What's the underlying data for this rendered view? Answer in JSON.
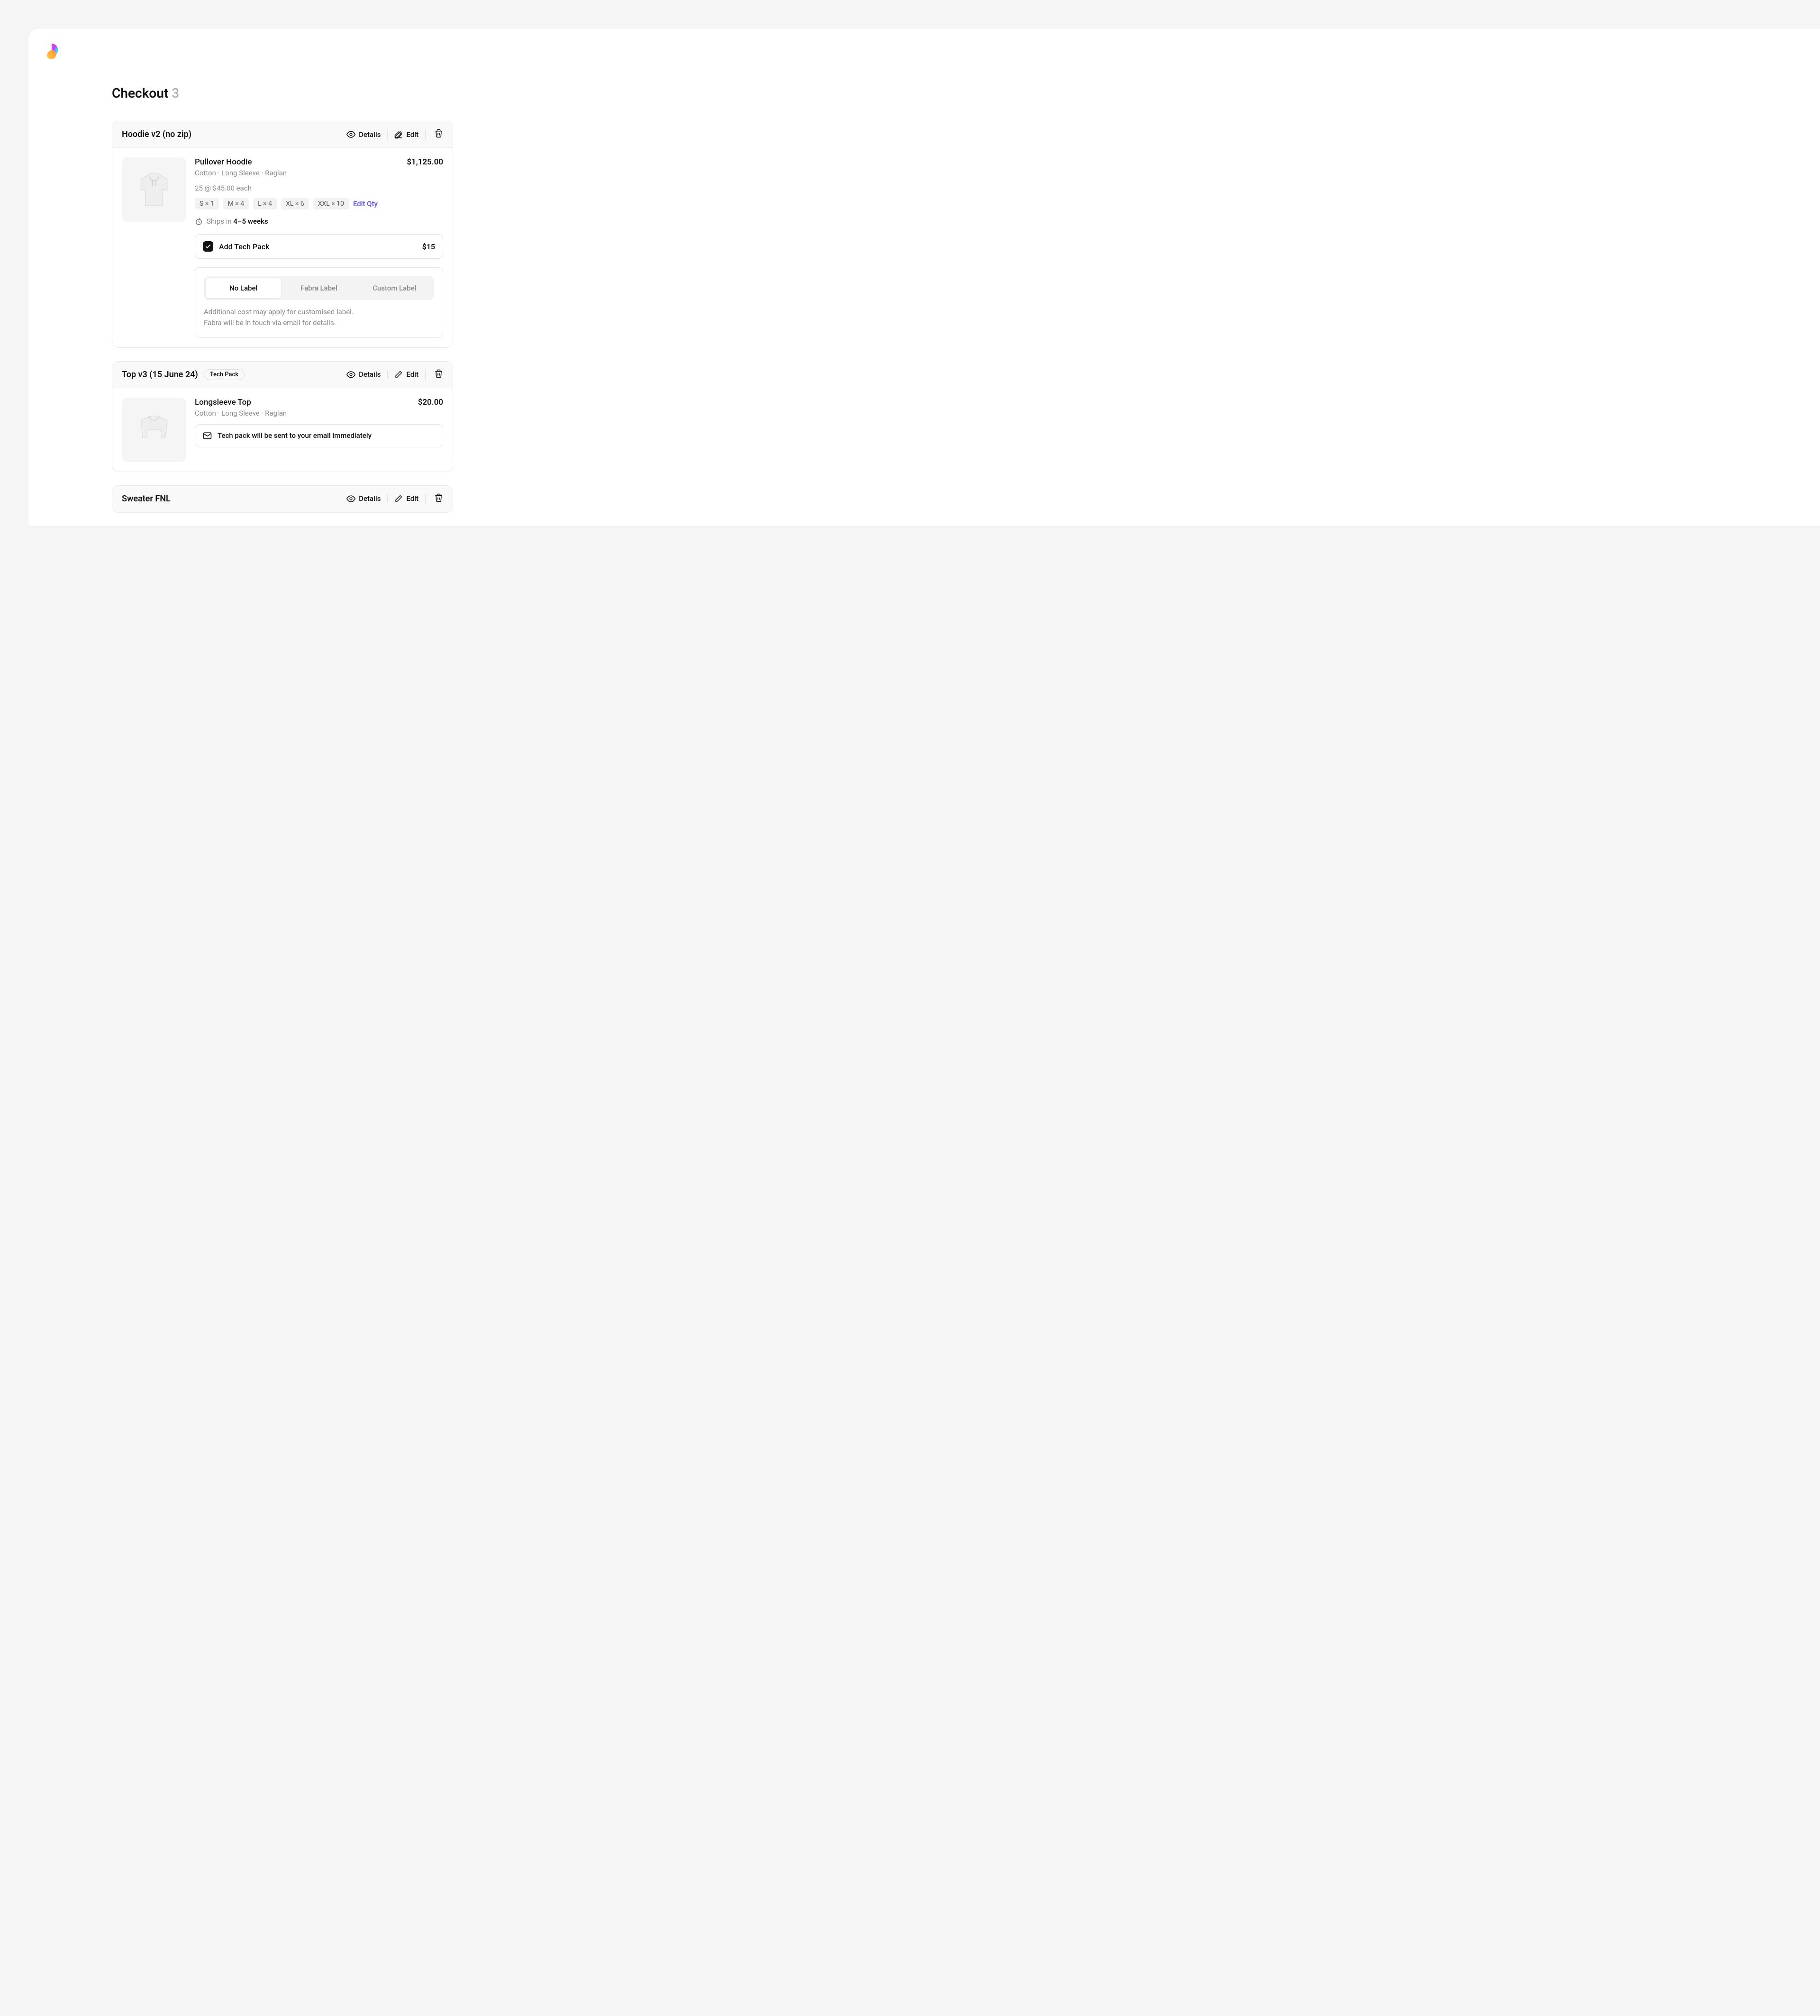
{
  "title": {
    "text": "Checkout",
    "count": "3"
  },
  "actions": {
    "details": "Details",
    "edit": "Edit"
  },
  "labelOptions": {
    "none": "No Label",
    "fabra": "Fabra Label",
    "custom": "Custom Label"
  },
  "labelNote": {
    "l1": "Additional cost may apply for customised label.",
    "l2": "Fabra will be in touch via email for details."
  },
  "editQty": "Edit Qty",
  "items": [
    {
      "title": "Hoodie v2 (no zip)",
      "name": "Pullover Hoodie",
      "price": "$1,125.00",
      "meta": "Cotton   ·   Long Sleeve   ·   Raglan",
      "qty": "25 @ $45.00 each",
      "sizes": [
        "S × 1",
        "M × 4",
        "L × 4",
        "XL × 6",
        "XXL × 10"
      ],
      "ships": {
        "pre": "Ships in ",
        "bold": "4–5 weeks"
      },
      "addon": {
        "label": "Add Tech Pack",
        "price": "$15",
        "checked": true
      },
      "hasLabel": true
    },
    {
      "title": "Top v3 (15 June 24)",
      "pill": "Tech Pack",
      "name": "Longsleeve Top",
      "price": "$20.00",
      "meta": "Cotton   ·   Long Sleeve   ·   Raglan",
      "info": "Tech pack will be sent to your email immediately"
    },
    {
      "title": "Sweater FNL"
    }
  ]
}
